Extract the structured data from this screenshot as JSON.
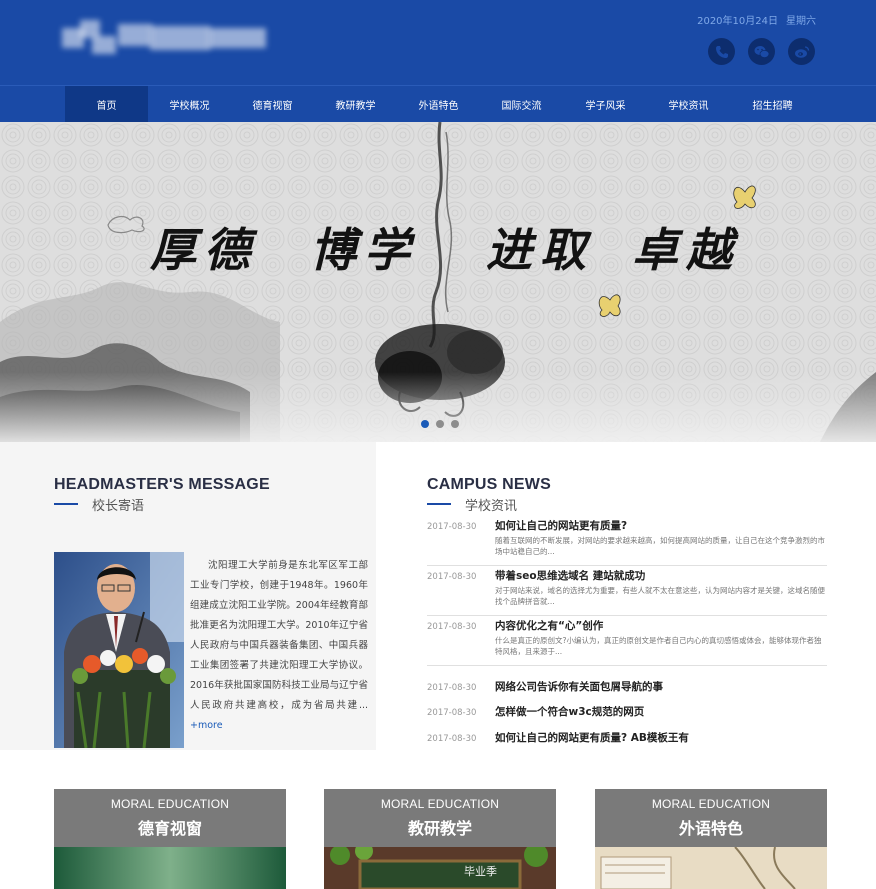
{
  "header": {
    "date": "2020年10月24日",
    "weekday": "星期六",
    "icons": [
      "phone-icon",
      "wechat-icon",
      "weibo-icon"
    ]
  },
  "nav": {
    "items": [
      "首页",
      "学校概况",
      "德育视窗",
      "教研教学",
      "外语特色",
      "国际交流",
      "学子风采",
      "学校资讯",
      "招生招聘"
    ],
    "active_index": 0
  },
  "banner": {
    "words": [
      "厚德",
      "博学",
      "进取",
      "卓越"
    ],
    "slides": 3,
    "active_slide": 0
  },
  "headmaster": {
    "title_en": "HEADMASTER'S MESSAGE",
    "title_cn": "校长寄语",
    "text": "沈阳理工大学前身是东北军区军工部工业专门学校，创建于1948年。1960年组建成立沈阳工业学院。2004年经教育部批准更名为沈阳理工大学。2010年辽宁省人民政府与中国兵器装备集团、中国兵器工业集团签署了共建沈阳理工大学协议。2016年获批国家国防科技工业局与辽宁省人民政府共建高校，成为省局共建...",
    "more": "+more"
  },
  "news": {
    "title_en": "CAMPUS NEWS",
    "title_cn": "学校资讯",
    "featured": [
      {
        "date": "2017-08-30",
        "title": "如何让自己的网站更有质量?",
        "summary": "随着互联网的不断发展，对网站的要求越来越高，如何提高网站的质量，让自己在这个竞争激烈的市场中站稳自己的..."
      },
      {
        "date": "2017-08-30",
        "title": "带着seo思维选域名 建站就成功",
        "summary": "对于网站来说，域名的选择尤为重要，有些人就不太在意这些，认为网站内容才是关键，这域名随便找个品牌拼音就..."
      },
      {
        "date": "2017-08-30",
        "title": "内容优化之有“心”创作",
        "summary": "什么是真正的原创文?小编认为，真正的原创文是作者自己内心的真切感悟或体会，能够体现作者独特风格，且来源于..."
      }
    ],
    "list": [
      {
        "date": "2017-08-30",
        "title": "网络公司告诉你有关面包屑导航的事"
      },
      {
        "date": "2017-08-30",
        "title": "怎样做一个符合w3c规范的网页"
      },
      {
        "date": "2017-08-30",
        "title": "如何让自己的网站更有质量? AB模板王有"
      }
    ]
  },
  "cards": [
    {
      "en": "MORAL EDUCATION",
      "cn": "德育视窗"
    },
    {
      "en": "MORAL EDUCATION",
      "cn": "教研教学",
      "image_text": "毕业季"
    },
    {
      "en": "MORAL EDUCATION",
      "cn": "外语特色"
    }
  ]
}
